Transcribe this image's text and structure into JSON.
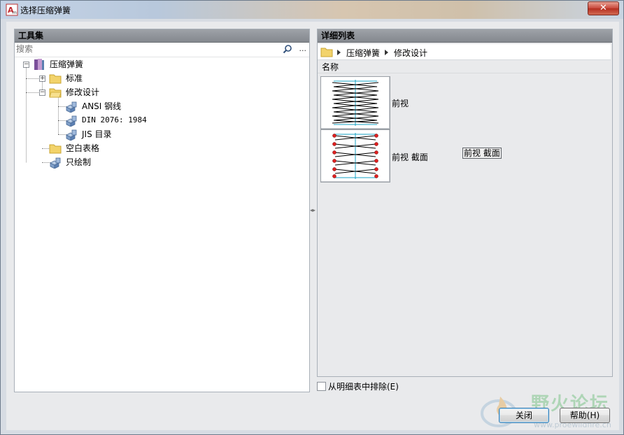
{
  "window": {
    "title": "选择压缩弹簧",
    "close_glyph": "✕"
  },
  "left_panel": {
    "header": "工具集",
    "search_placeholder": "搜索",
    "search_more": "...",
    "tree": [
      {
        "label": "压缩弹簧",
        "level": 0,
        "icon": "book-icon",
        "expander": "minus"
      },
      {
        "label": "标准",
        "level": 1,
        "icon": "folder-icon",
        "expander": "plus"
      },
      {
        "label": "修改设计",
        "level": 1,
        "icon": "folder-icon",
        "expander": "minus"
      },
      {
        "label": "ANSI 钢线",
        "level": 2,
        "icon": "part-icon"
      },
      {
        "label": "DIN 2076: 1984",
        "level": 2,
        "icon": "part-icon"
      },
      {
        "label": "JIS 目录",
        "level": 2,
        "icon": "part-icon"
      },
      {
        "label": "空白表格",
        "level": 1,
        "icon": "folder-icon"
      },
      {
        "label": "只绘制",
        "level": 1,
        "icon": "part-icon"
      }
    ]
  },
  "right_panel": {
    "header": "详细列表",
    "breadcrumb": [
      "压缩弹簧",
      "修改设计"
    ],
    "column_header": "名称",
    "items": [
      {
        "label": "前视",
        "icon": "spring-front-view-icon"
      },
      {
        "label": "前视 截面",
        "icon": "spring-section-view-icon"
      }
    ],
    "tooltip": "前视 截面"
  },
  "exclude_checkbox": {
    "label": "从明细表中排除(E)",
    "checked": false
  },
  "buttons": {
    "close": "关闭",
    "help": "帮助(H)"
  },
  "watermark": {
    "text": "野火论坛",
    "url": "www.proewildfire.cn"
  },
  "colors": {
    "panel_header": "#9ea2a8",
    "spring_line": "#19a3c4",
    "section_marker": "#e02020"
  }
}
